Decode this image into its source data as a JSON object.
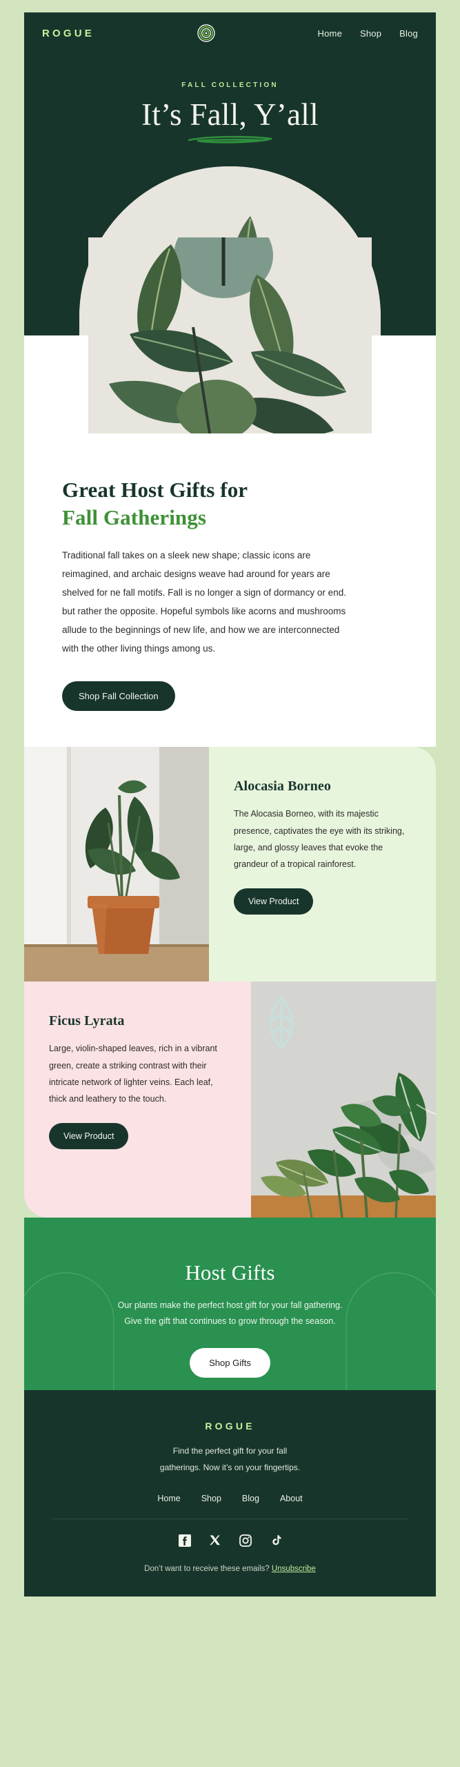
{
  "header": {
    "brand": "ROGUE",
    "logo_icon": "concentric-circles-icon",
    "nav": [
      {
        "label": "Home"
      },
      {
        "label": "Shop"
      },
      {
        "label": "Blog"
      }
    ]
  },
  "hero": {
    "eyebrow": "FALL COLLECTION",
    "title": "It’s Fall, Y’all",
    "underline_icon": "brush-stroke-underline-icon",
    "image_alt": "rubber-plant-photo"
  },
  "intro": {
    "heading_line1": "Great Host Gifts for",
    "heading_line2": "Fall Gatherings",
    "body": "Traditional fall takes on a sleek new shape; classic icons are reimagined, and archaic designs weave had around for years are shelved for ne fall motifs. Fall is no longer a sign of dormancy or end. but rather the opposite. Hopeful symbols like acorns and mushrooms allude to the beginnings of new life, and how we are interconnected with the other living things among us.",
    "cta": "Shop Fall Collection"
  },
  "products": [
    {
      "title": "Alocasia Borneo",
      "description": "The Alocasia Borneo, with its majestic presence, captivates the eye with its striking, large, and glossy leaves that evoke the grandeur of a tropical rainforest.",
      "cta": "View Product",
      "image_alt": "alocasia-borneo-photo"
    },
    {
      "title": "Ficus Lyrata",
      "description": "Large, violin-shaped leaves, rich in a vibrant green, create a striking contrast with their intricate network of lighter veins. Each leaf, thick and leathery to the touch.",
      "cta": "View Product",
      "image_alt": "ficus-lyrata-photo"
    }
  ],
  "gifts": {
    "title": "Host Gifts",
    "subtitle_line1": "Our plants make the perfect host gift for your fall gathering.",
    "subtitle_line2": "Give the gift that continues to grow through the season.",
    "cta": "Shop Gifts"
  },
  "footer": {
    "brand": "ROGUE",
    "tagline_line1": "Find the perfect gift for your fall",
    "tagline_line2": "gatherings. Now it’s on your fingertips.",
    "nav": [
      {
        "label": "Home"
      },
      {
        "label": "Shop"
      },
      {
        "label": "Blog"
      },
      {
        "label": "About"
      }
    ],
    "socials": [
      {
        "name": "facebook-icon"
      },
      {
        "name": "x-twitter-icon"
      },
      {
        "name": "instagram-icon"
      },
      {
        "name": "tiktok-icon"
      }
    ],
    "unsubscribe_text": "Don’t want to receive these emails?",
    "unsubscribe_link": "Unsubscribe"
  },
  "colors": {
    "page_bg": "#d2e5bf",
    "dark_green": "#18352c",
    "bright_green": "#3e9136",
    "section_green": "#2a9150",
    "lime": "#ccef9c",
    "mint_card": "#e8f5dd",
    "pink_card": "#fbe2e4",
    "white": "#ffffff"
  }
}
